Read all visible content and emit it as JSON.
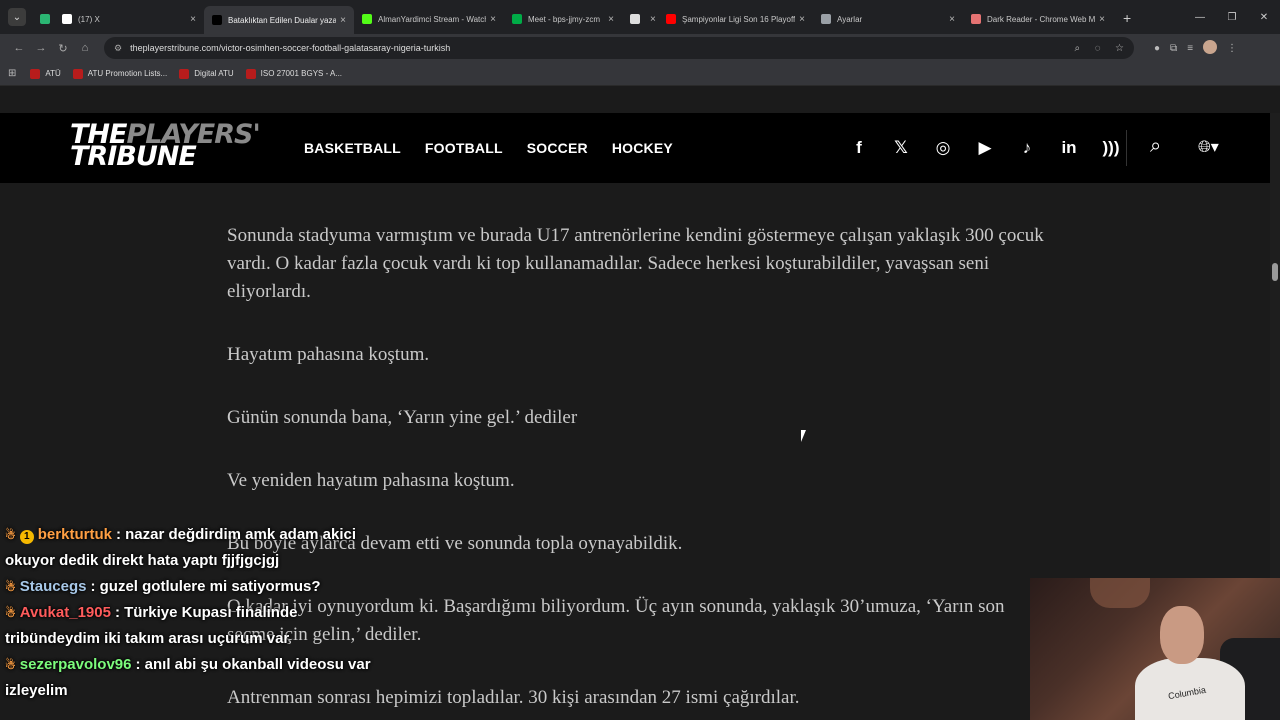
{
  "browser": {
    "tabs": [
      {
        "title": "",
        "favicon_color": "#2bb673",
        "active": false,
        "has_close": false
      },
      {
        "title": "(17) X",
        "favicon_color": "#ffffff",
        "active": false,
        "has_close": true
      },
      {
        "title": "Bataklıktan Edilen Dualar yazar",
        "favicon_color": "#000000",
        "active": true,
        "has_close": true
      },
      {
        "title": "AlmanYardimci Stream - Watch",
        "favicon_color": "#53fc18",
        "active": false,
        "has_close": true
      },
      {
        "title": "Meet - bps-jjmy-zcm",
        "favicon_color": "#00ac47",
        "active": false,
        "has_close": true
      },
      {
        "title": "",
        "favicon_color": "#dddddd",
        "active": false,
        "has_close": true
      },
      {
        "title": "Şampiyonlar Ligi Son 16 Playoff",
        "favicon_color": "#ff0000",
        "active": false,
        "has_close": true
      },
      {
        "title": "Ayarlar",
        "favicon_color": "#9aa0a6",
        "active": false,
        "has_close": true
      },
      {
        "title": "Dark Reader - Chrome Web Mağazası",
        "favicon_color": "#e57373",
        "active": false,
        "has_close": true
      }
    ],
    "url": "theplayerstribune.com/victor-osimhen-soccer-football-galatasaray-nigeria-turkish",
    "bookmarks": [
      {
        "label": "ATÜ"
      },
      {
        "label": "ATU Promotion Lists..."
      },
      {
        "label": "Digital ATU"
      },
      {
        "label": "ISO 27001 BGYS - A..."
      }
    ]
  },
  "site": {
    "logo_line1_a": "THE",
    "logo_line1_b": "PLAYERS'",
    "logo_line2": "TRIBUNE",
    "nav": [
      "BASKETBALL",
      "FOOTBALL",
      "SOCCER",
      "HOCKEY"
    ],
    "social_icons": [
      "f",
      "𝕏",
      "◎",
      "▶",
      "♪",
      "in",
      ")))"
    ]
  },
  "article": {
    "paragraphs": [
      "Sonunda stadyuma varmıştım ve burada U17 antrenörlerine kendini göstermeye çalışan yaklaşık 300 çocuk vardı. O kadar fazla çocuk vardı ki top kullanamadılar. Sadece herkesi koşturabildiler, yavaşsan seni eliyorlardı.",
      "Hayatım pahasına koştum.",
      "Günün sonunda bana, ‘Yarın yine gel.’ dediler",
      "Ve yeniden hayatım pahasına koştum.",
      "Bu böyle aylarca devam etti ve sonunda topla oynayabildik.",
      "O kadar iyi oynuyordum ki. Başardığımı biliyordum. Üç ayın sonunda, yaklaşık 30’umuza, ‘Yarın son seçme için gelin,’ dediler.",
      "Antrenman sonrası hepimizi topladılar. 30 kişi arasından 27 ismi çağırdılar."
    ]
  },
  "chat": {
    "messages": [
      {
        "user": "berkturtuk",
        "color": "#ff9f43",
        "badge": "1",
        "text": ": nazar değdirdim amk adam akici okuyor dedik direkt hata yaptı fjjfjgcjgj"
      },
      {
        "user": "Staucegs",
        "color": "#a7c7e7",
        "badge": "",
        "text": ": guzel gotlulere mi satiyormus?"
      },
      {
        "user": "Avukat_1905",
        "color": "#ff5c5c",
        "badge": "",
        "text": ": Türkiye Kupası finalinde tribündeydim iki takım arası uçurum var"
      },
      {
        "user": "sezerpavolov96",
        "color": "#7cfc7c",
        "badge": "",
        "text": ": anıl abi şu okanball videosu var izleyelim"
      }
    ]
  },
  "webcam": {
    "shirt_text": "Columbia"
  }
}
